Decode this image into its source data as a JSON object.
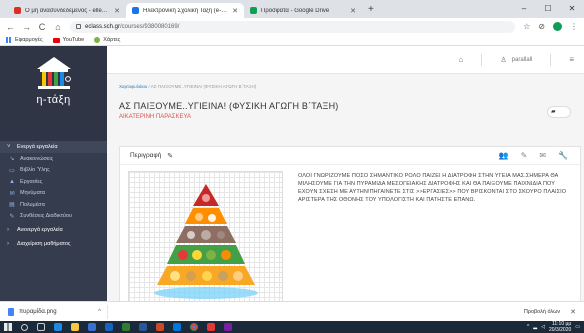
{
  "browser": {
    "tabs": [
      {
        "label": "Ο μη ανασυνδεδεμένος - ellesn@it...",
        "favicon_color": "#d93025",
        "active": false
      },
      {
        "label": "Ηλεκτρονική Σχολική Τάξη (e-Cl...",
        "favicon_color": "#1a73e8",
        "active": true
      },
      {
        "label": "Προσφάτα - Google Drive",
        "favicon_color": "#0f9d58",
        "active": false
      }
    ],
    "new_tab": "+",
    "window_controls": {
      "minimize": "–",
      "maximize": "☐",
      "close": "✕"
    },
    "nav": {
      "back": "←",
      "forward": "→",
      "reload": "C",
      "home": "⌂"
    },
    "url_host": "eclass.sch.gr",
    "url_path": "/courses/9380080169/",
    "toolbar_icons": {
      "star": "☆",
      "extension": "⊘"
    },
    "bookmarks": [
      {
        "label": "Εφαρμογές",
        "icon": "apps-icon"
      },
      {
        "label": "YouTube",
        "icon": "youtube-icon"
      },
      {
        "label": "Χάρτες",
        "icon": "maps-icon"
      }
    ]
  },
  "sidebar": {
    "logo_text": "η-τάξη",
    "sections": [
      {
        "label": "Ενεργά εργαλεία",
        "expanded": true,
        "items": [
          {
            "label": "Ανακοινώσεις",
            "icon": "↘"
          },
          {
            "label": "Βιβλίο Ύλης",
            "icon": "▭"
          },
          {
            "label": "Εργασίες",
            "icon": "▲"
          },
          {
            "label": "Μηνύματα",
            "icon": "✉"
          },
          {
            "label": "Πολυμέσα",
            "icon": "▤"
          },
          {
            "label": "Συνθέσεις Διαδικτύου",
            "icon": "✎"
          }
        ]
      },
      {
        "label": "Ανενεργά εργαλεία",
        "expanded": false
      },
      {
        "label": "Διαχείριση μαθήματος",
        "expanded": false
      }
    ]
  },
  "topbar": {
    "home_icon": "⌂",
    "user_name": "parallall",
    "menu_icon": "≡"
  },
  "breadcrumb": {
    "home": "Χαρτοφυλάκιο",
    "sep": " / ",
    "current": "ΑΣ ΠΑΙΞΟΥΜΕ..ΥΓΙΕΙΝΑ! (ΦΥΣΙΚΗ ΑΓΩΓΗ Β΄ΤΑΞΗ)"
  },
  "course": {
    "title": "ΑΣ ΠΑΙΞΟΥΜΕ..ΥΓΙΕΙΝΑ! (ΦΥΣΙΚΗ ΑΓΩΓΗ Β΄ΤΑΞΗ)",
    "author": "ΑΙΚΑΤΕΡΙΝΗ ΠΑΡΑΣΚΕΥΑ"
  },
  "panel": {
    "header": "Περιγραφή",
    "description": "ΟΛΟΙ ΓΝΩΡΙΖΟΥΜΕ ΠΟΣΟ ΣΗΜΑΝΤΙΚΟ ΡΟΛΟ ΠΑΙΖΕΙ Η ΔΙΑΤΡΟΦΗ ΣΤΗΝ ΥΓΕΙΑ ΜΑΣ.ΣΗΜΕΡΑ ΘΑ ΜΙΛΗΣΟΥΜΕ ΓΙΑ ΤΗΝ ΠΥΡΑΜΙΔΑ ΜΕΣΟΓΕΙΑΚΗΣ ΔΙΑΤΡΟΦΗΣ ΚΑΙ ΘΑ ΠΑΙΞΟΥΜΕ ΠΑΙΧΝΙΔΙΑ ΠΟΥ ΕΧΟΥΝ ΣΧΕΣΗ ΜΕ ΑΥΤΗΝ!ΠΗΓΑΙΝΕΤΕ ΣΤΙΣ >>ΕΡΓΑΣΙΕΣ>> ΠΟΥ ΒΡΙΣΚΟΝΤΑΙ ΣΤΟ ΣΚΟΥΡΟ ΠΛΑΙΣΙΟ ΑΡΙΣΤΕΡΑ ΤΗΣ ΟΘΟΝΗΣ ΤΟΥ ΥΠΟΛΟΓΙΣΤΗ ΚΑΙ ΠΑΤΗΣΤΕ ΕΠΑΝΩ."
  },
  "download": {
    "file": "πυραμίδα.png",
    "caret": "^",
    "show_all": "Προβολή όλων",
    "close": "✕"
  },
  "taskbar": {
    "time": "11:10 μμ",
    "date": "20/3/2020"
  }
}
